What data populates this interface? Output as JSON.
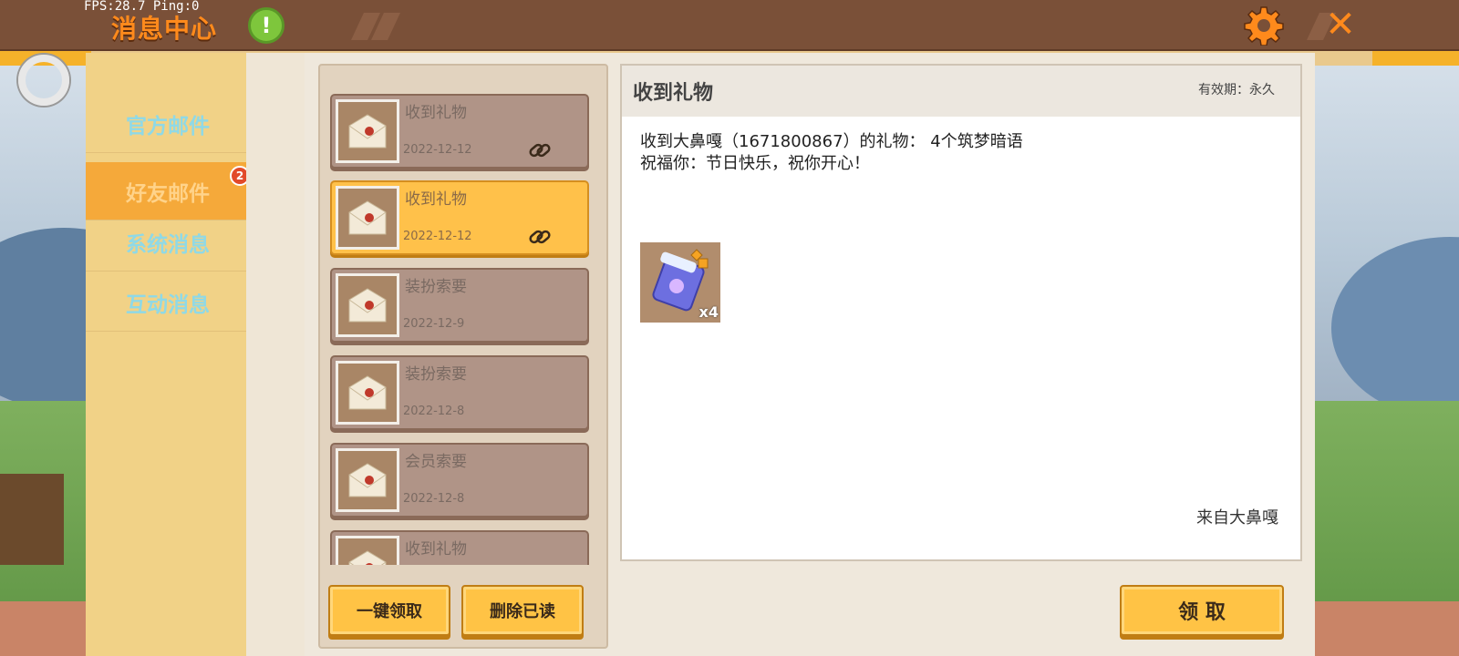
{
  "overlay": {
    "fps": "FPS:28.7  Ping:0"
  },
  "header": {
    "title": "消息中心",
    "alert_icon": "!",
    "close_icon": "✕"
  },
  "sidebar": {
    "items": [
      {
        "label": "官方邮件"
      },
      {
        "label": "好友邮件",
        "badge": "2"
      },
      {
        "label": "系统消息"
      },
      {
        "label": "互动消息"
      }
    ]
  },
  "mail_list": [
    {
      "title": "收到礼物",
      "date": "2022-12-12"
    },
    {
      "title": "收到礼物",
      "date": "2022-12-12"
    },
    {
      "title": "装扮索要",
      "date": "2022-12-9"
    },
    {
      "title": "装扮索要",
      "date": "2022-12-8"
    },
    {
      "title": "会员索要",
      "date": "2022-12-8"
    },
    {
      "title": "收到礼物",
      "date": ""
    }
  ],
  "buttons": {
    "claim_all": "一键领取",
    "delete_read": "删除已读",
    "claim": "领 取"
  },
  "detail": {
    "title": "收到礼物",
    "validity": "有效期：永久",
    "line1": "收到大鼻嘎（1671800867）的礼物： 4个筑梦暗语",
    "line2": "祝福你：节日快乐，祝你开心！",
    "item_count": "x4",
    "from": "来自大鼻嘎"
  },
  "colors": {
    "accent": "#ffc345",
    "title": "#ff8a1c",
    "topbar": "#7a5038"
  }
}
